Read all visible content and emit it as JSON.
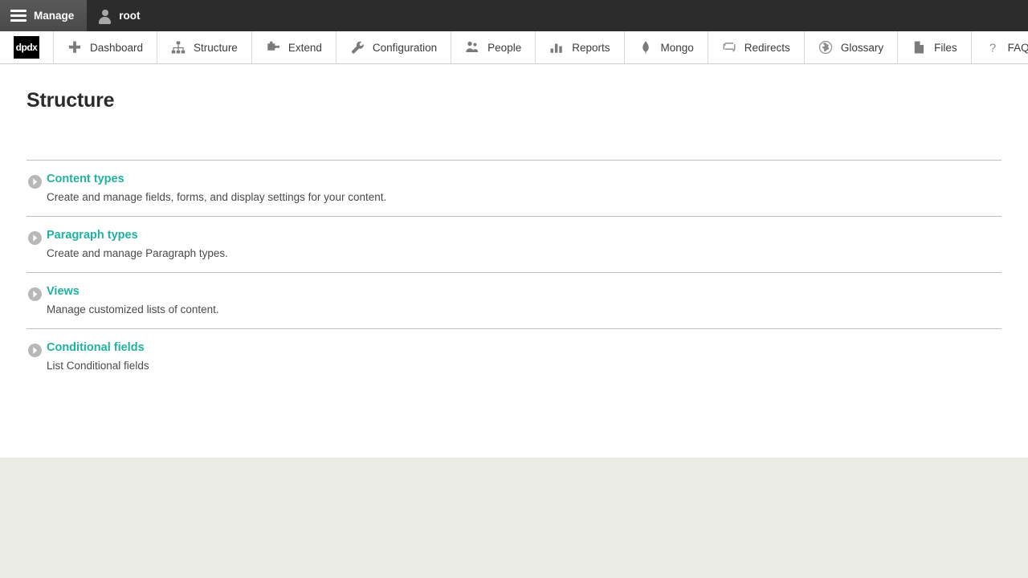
{
  "toolbar": {
    "manage_label": "Manage",
    "user_label": "root",
    "menu_icon_name": "hamburger-icon",
    "user_icon_name": "user-icon"
  },
  "menu": {
    "logo_text": "dpdx",
    "items": [
      {
        "label": "Dashboard",
        "icon": "plus-icon"
      },
      {
        "label": "Structure",
        "icon": "hierarchy-icon"
      },
      {
        "label": "Extend",
        "icon": "puzzle-piece-icon"
      },
      {
        "label": "Configuration",
        "icon": "wrench-icon"
      },
      {
        "label": "People",
        "icon": "people-icon"
      },
      {
        "label": "Reports",
        "icon": "bar-chart-icon"
      },
      {
        "label": "Mongo",
        "icon": "leaf-icon"
      },
      {
        "label": "Redirects",
        "icon": "swap-arrows-icon"
      },
      {
        "label": "Glossary",
        "icon": "globe-icon"
      },
      {
        "label": "Files",
        "icon": "document-icon"
      },
      {
        "label": "FAQ",
        "icon": "question-mark-icon"
      }
    ],
    "collapse_icon": "collapse-left-icon"
  },
  "page": {
    "title": "Structure",
    "items": [
      {
        "link": "Content types",
        "description": "Create and manage fields, forms, and display settings for your content."
      },
      {
        "link": "Paragraph types",
        "description": "Create and manage Paragraph types."
      },
      {
        "link": "Views",
        "description": "Manage customized lists of content."
      },
      {
        "link": "Conditional fields",
        "description": "List Conditional fields"
      }
    ]
  },
  "colors": {
    "link_teal": "#20b2a0",
    "toolbar_dark": "#2c2c2c",
    "toolbar_active": "#4f4f4f",
    "footer_bg": "#ecece6",
    "rule": "#bfbfbf"
  }
}
